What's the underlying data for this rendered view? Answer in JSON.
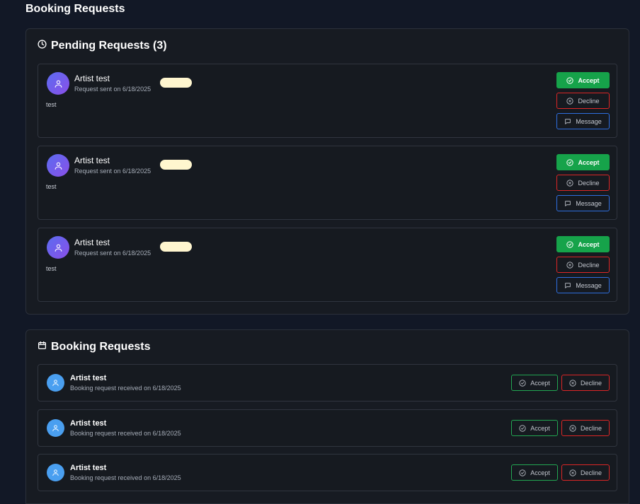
{
  "page_title": "Booking Requests",
  "pending": {
    "heading": "Pending Requests (3)",
    "heading_icon": "clock-icon",
    "requests": [
      {
        "name": "Artist test",
        "subtitle": "Request sent on 6/18/2025",
        "message": "test",
        "accept_label": "Accept",
        "decline_label": "Decline",
        "message_label": "Message"
      },
      {
        "name": "Artist test",
        "subtitle": "Request sent on 6/18/2025",
        "message": "test",
        "accept_label": "Accept",
        "decline_label": "Decline",
        "message_label": "Message"
      },
      {
        "name": "Artist test",
        "subtitle": "Request sent on 6/18/2025",
        "message": "test",
        "accept_label": "Accept",
        "decline_label": "Decline",
        "message_label": "Message"
      }
    ]
  },
  "booking": {
    "heading": "Booking Requests",
    "heading_icon": "calendar-icon",
    "requests": [
      {
        "name": "Artist test",
        "subtitle": "Booking request received on 6/18/2025",
        "accept_label": "Accept",
        "decline_label": "Decline"
      },
      {
        "name": "Artist test",
        "subtitle": "Booking request received on 6/18/2025",
        "accept_label": "Accept",
        "decline_label": "Decline"
      },
      {
        "name": "Artist test",
        "subtitle": "Booking request received on 6/18/2025",
        "accept_label": "Accept",
        "decline_label": "Decline"
      }
    ]
  },
  "colors": {
    "background": "#121826",
    "panel": "#171b22",
    "accept": "#16a34a",
    "decline": "#dc2626",
    "message": "#2f6fe0",
    "badge": "#fff6cf"
  }
}
